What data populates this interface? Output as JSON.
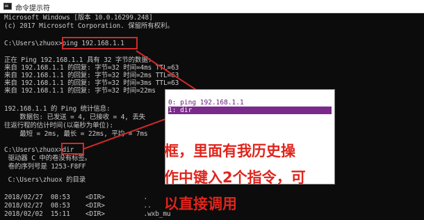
{
  "window": {
    "title": "命令提示符"
  },
  "console": {
    "lines": [
      "Microsoft Windows [版本 10.0.16299.248]",
      "(c) 2017 Microsoft Corporation. 保留所有权利。",
      "",
      "C:\\Users\\zhuox>ping 192.168.1.1",
      "",
      "正在 Ping 192.168.1.1 具有 32 字节的数据:",
      "来自 192.168.1.1 的回复: 字节=32 时间=4ms TTL=63",
      "来自 192.168.1.1 的回复: 字节=32 时间=2ms TTL=63",
      "来自 192.168.1.1 的回复: 字节=32 时间=3ms TTL=63",
      "来自 192.168.1.1 的回复: 字节=32 时间=22ms",
      "",
      "192.168.1.1 的 Ping 统计信息:",
      "    数据包: 已发送 = 4, 已接收 = 4, 丢失",
      "往返行程的估计时间(以毫秒为单位):",
      "    最短 = 2ms, 最长 = 22ms, 平均 = 7ms",
      "",
      "C:\\Users\\zhuox>dir",
      " 驱动器 C 中的卷没有标签。",
      " 卷的序列号是 1253-F8FF",
      "",
      " C:\\Users\\zhuox 的目录",
      "",
      "2018/02/27  08:53    <DIR>          .",
      "2018/02/27  08:53    <DIR>          ..",
      "2018/02/02  15:11    <DIR>          .wxb_mu"
    ]
  },
  "history_popup": {
    "items": [
      "0: ping 192.168.1.1",
      "1: dir"
    ],
    "selected_index": 1
  },
  "annotation": {
    "lines": [
      "框，里面有我历史操",
      "作中键入2个指令，可",
      "以直接调用"
    ],
    "color": "#e0241c"
  }
}
